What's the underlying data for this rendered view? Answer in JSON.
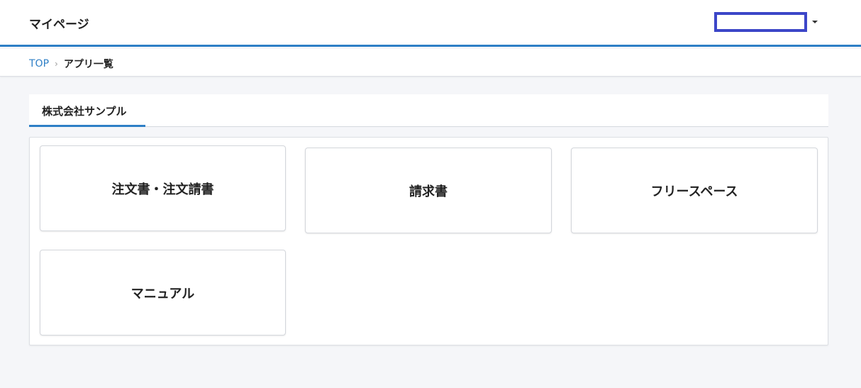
{
  "header": {
    "title": "マイページ"
  },
  "breadcrumb": {
    "home": "TOP",
    "separator": "›",
    "current": "アプリ一覧"
  },
  "tabs": [
    {
      "label": "株式会社サンプル"
    }
  ],
  "apps": [
    {
      "label": "注文書・注文請書"
    },
    {
      "label": "請求書"
    },
    {
      "label": "フリースペース"
    },
    {
      "label": "マニュアル"
    }
  ],
  "colors": {
    "accent": "#2e7fc6",
    "user_box_border": "#3c46c8",
    "background": "#f5f6f9"
  },
  "icons": {
    "user_menu": "caret-down-icon",
    "breadcrumb_sep": "chevron-right-icon"
  }
}
